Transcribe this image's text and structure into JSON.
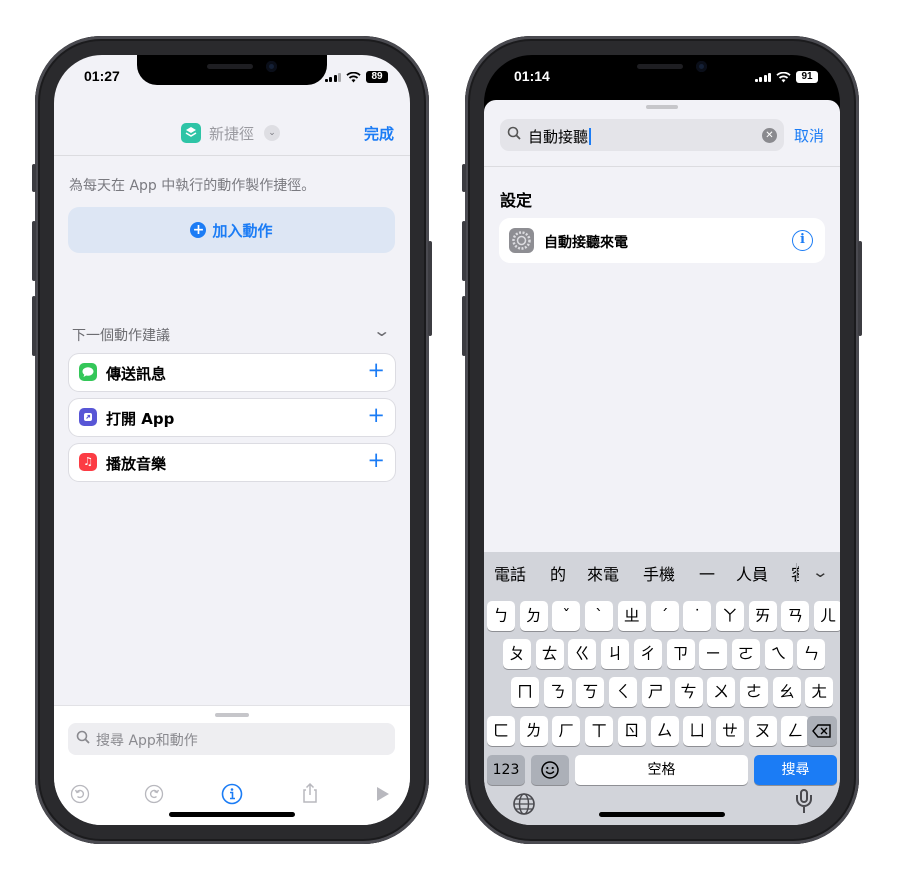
{
  "left_phone": {
    "status": {
      "time": "01:27",
      "battery": "89"
    },
    "nav": {
      "title": "新捷徑",
      "done": "完成"
    },
    "description": "為每天在 App 中執行的動作製作捷徑。",
    "add_action": "加入動作",
    "suggestions_header": "下一個動作建議",
    "suggestions": [
      {
        "label": "傳送訊息",
        "icon": "messages-icon",
        "color": "#34c759"
      },
      {
        "label": "打開 App",
        "icon": "open-app-icon",
        "color": "#5856d6"
      },
      {
        "label": "播放音樂",
        "icon": "music-icon",
        "color": "#fc3c44"
      }
    ],
    "search_placeholder": "搜尋 App和動作",
    "toolbar": [
      "undo-icon",
      "redo-icon",
      "info-icon",
      "share-icon",
      "play-icon"
    ]
  },
  "right_phone": {
    "status": {
      "time": "01:14",
      "battery": "91"
    },
    "search": {
      "value": "自動接聽"
    },
    "cancel": "取消",
    "section": "設定",
    "result": {
      "label": "自動接聽來電",
      "icon": "settings-gear-icon"
    },
    "keyboard": {
      "candidates": [
        "電話",
        "的",
        "來電",
        "手機",
        "一",
        "人員",
        "客"
      ],
      "rows": [
        [
          "ㄅ",
          "ㄉ",
          "ˇ",
          "ˋ",
          "ㄓ",
          "ˊ",
          "˙",
          "ㄚ",
          "ㄞ",
          "ㄢ",
          "ㄦ"
        ],
        [
          "ㄆ",
          "ㄊ",
          "ㄍ",
          "ㄐ",
          "ㄔ",
          "ㄗ",
          "ㄧ",
          "ㄛ",
          "ㄟ",
          "ㄣ"
        ],
        [
          "ㄇ",
          "ㄋ",
          "ㄎ",
          "ㄑ",
          "ㄕ",
          "ㄘ",
          "ㄨ",
          "ㄜ",
          "ㄠ",
          "ㄤ"
        ],
        [
          "ㄈ",
          "ㄌ",
          "ㄏ",
          "ㄒ",
          "ㄖ",
          "ㄙ",
          "ㄩ",
          "ㄝ",
          "ㄡ",
          "ㄥ"
        ]
      ],
      "numbers_key": "123",
      "space_key": "空格",
      "search_key": "搜尋"
    }
  }
}
